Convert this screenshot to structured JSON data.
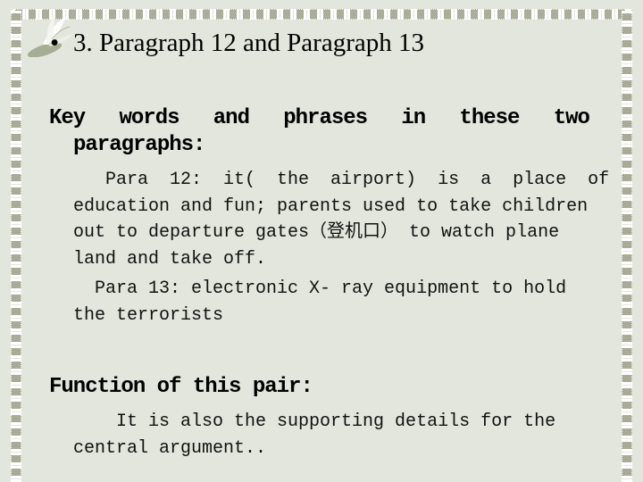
{
  "slide": {
    "title_bullet": "•",
    "title": "3.  Paragraph 12 and Paragraph 13",
    "key_words": {
      "heading_words": [
        "Key",
        "words",
        "and",
        "phrases",
        "in",
        "these",
        "two"
      ],
      "heading_line2": "paragraphs:",
      "para12": {
        "lines": [
          "   Para  12:  it(  the  airport)  is  a  place  of",
          "education and fun; parents used to take children",
          "out to departure gates（登机口） to watch plane",
          "land and take off."
        ]
      },
      "para13": {
        "lines": [
          "  Para 13: electronic X- ray equipment to hold",
          "the terrorists"
        ]
      }
    },
    "function": {
      "heading": "Function of this pair:",
      "lines": [
        "    It is also the supporting details for the",
        "central argument.."
      ]
    }
  },
  "decoration": {
    "icon": "lily-flower-icon",
    "border": "chain-border",
    "background_color": "#e3e6dc",
    "border_color": "#a9ab98"
  }
}
